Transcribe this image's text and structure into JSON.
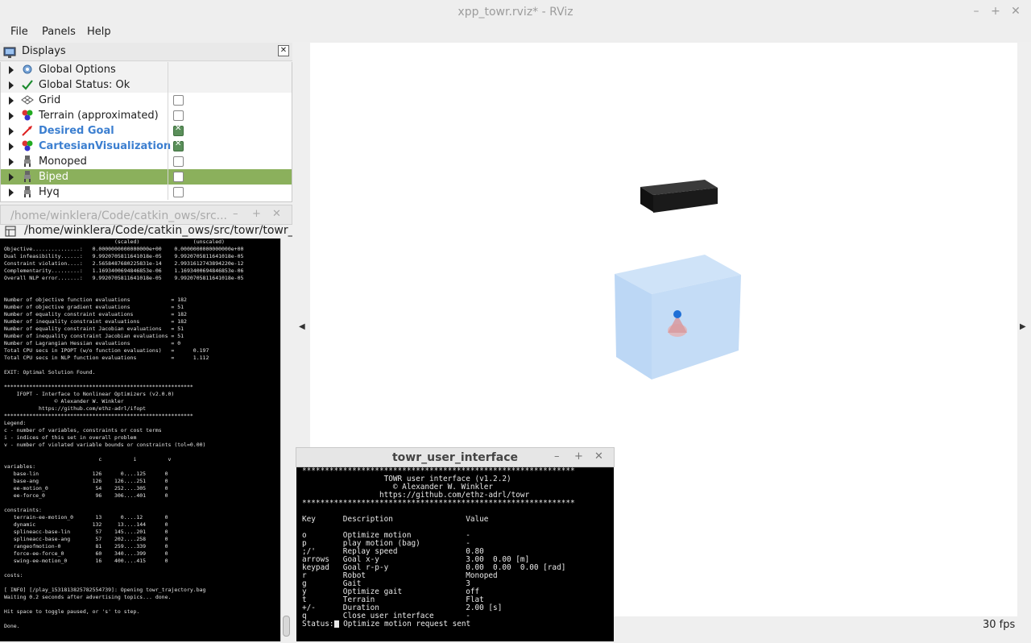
{
  "window": {
    "title": "xpp_towr.rviz* - RViz"
  },
  "menu": {
    "file": "File",
    "panels": "Panels",
    "help": "Help"
  },
  "displays": {
    "title": "Displays",
    "items": [
      {
        "label": "Global Options",
        "icon": "gear-icon",
        "checked": null,
        "style": "plain"
      },
      {
        "label": "Global Status: Ok",
        "icon": "checkmark-icon",
        "checked": null,
        "style": "plain"
      },
      {
        "label": "Grid",
        "icon": "grid-icon",
        "checked": false,
        "style": "plain"
      },
      {
        "label": "Terrain (approximated)",
        "icon": "markers-icon",
        "checked": false,
        "style": "plain"
      },
      {
        "label": "Desired Goal",
        "icon": "arrow-icon",
        "checked": true,
        "style": "blue"
      },
      {
        "label": "CartesianVisualization",
        "icon": "markers-icon",
        "checked": true,
        "style": "blue"
      },
      {
        "label": "Monoped",
        "icon": "robot-icon",
        "checked": false,
        "style": "plain"
      },
      {
        "label": "Biped",
        "icon": "robot-icon",
        "checked": false,
        "style": "selected"
      },
      {
        "label": "Hyq",
        "icon": "robot-icon",
        "checked": false,
        "style": "plain"
      }
    ]
  },
  "viewport": {
    "fps": "30 fps"
  },
  "terminal_left": {
    "title": "/home/winklera/Code/catkin_ows/src...",
    "path": "/home/winklera/Code/catkin_ows/src/towr/towr_ros",
    "lines": [
      "                                   (scaled)                 (unscaled)",
      "Objective...............:   0.0000000000000000e+00    0.0000000000000000e+00",
      "Dual infeasibility......:   9.9920705811641018e-05    9.9920705811641018e-05",
      "Constraint violation....:   2.5658487680225831e-14    2.9931612743894220e-12",
      "Complementarity.........:   1.1693400694846853e-06    1.1693400694846853e-06",
      "Overall NLP error.......:   9.9920705811641018e-05    9.9920705811641018e-05",
      "",
      "",
      "Number of objective function evaluations             = 182",
      "Number of objective gradient evaluations             = 51",
      "Number of equality constraint evaluations            = 182",
      "Number of inequality constraint evaluations          = 182",
      "Number of equality constraint Jacobian evaluations   = 51",
      "Number of inequality constraint Jacobian evaluations = 51",
      "Number of Lagrangian Hessian evaluations             = 0",
      "Total CPU secs in IPOPT (w/o function evaluations)   =      0.197",
      "Total CPU secs in NLP function evaluations           =      1.112",
      "",
      "EXIT: Optimal Solution Found.",
      "",
      "************************************************************",
      "    IFOPT - Interface to Nonlinear Optimizers (v2.0.0)",
      "                © Alexander W. Winkler",
      "           https://github.com/ethz-adrl/ifopt",
      "************************************************************",
      "Legend:",
      "c - number of variables, constraints or cost terms",
      "i - indices of this set in overall problem",
      "v - number of violated variable bounds or constraints (tol=0.00)",
      "",
      "                              c          i          v",
      "variables:",
      "   base-lin                 126      0....125      0",
      "   base-ang                 126    126....251      0",
      "   ee-motion_0               54    252....305      0",
      "   ee-force_0                96    306....401      0",
      "",
      "constraints:",
      "   terrain-ee-motion_0       13      0....12       0",
      "   dynamic                  132     13....144      0",
      "   splineacc-base-lin        57    145....201      0",
      "   splineacc-base-ang        57    202....258      0",
      "   rangeofmotion-0           81    259....339      0",
      "   force-ee-force_0          60    340....399      0",
      "   swing-ee-motion_0         16    400....415      0",
      "",
      "costs:",
      "",
      "[ INFO] [/play_1531813825782554739]: Opening towr_trajectory.bag",
      "Waiting 0.2 seconds after advertising topics... done.",
      "",
      "Hit space to toggle paused, or 's' to step.",
      "",
      "Done."
    ]
  },
  "towr_ui": {
    "title": "towr_user_interface",
    "lines": [
      "************************************************************",
      "                  TOWR user interface (v1.2.2)",
      "                    © Alexander W. Winkler",
      "                 https://github.com/ethz-adrl/towr",
      "************************************************************",
      "",
      "Key      Description                Value",
      "",
      "o        Optimize motion            -",
      "p        play motion (bag)          -",
      ";/'      Replay speed               0.80",
      "arrows   Goal x-y                   3.00  0.00 [m]",
      "keypad   Goal r-p-y                 0.00  0.00  0.00 [rad]",
      "r        Robot                      Monoped",
      "g        Gait                       3",
      "y        Optimize gait              off",
      "t        Terrain                    Flat",
      "+/-      Duration                   2.00 [s]",
      "q        Close user interface       -",
      ""
    ],
    "status_label": "Status:",
    "status_text": " Optimize motion request sent"
  }
}
